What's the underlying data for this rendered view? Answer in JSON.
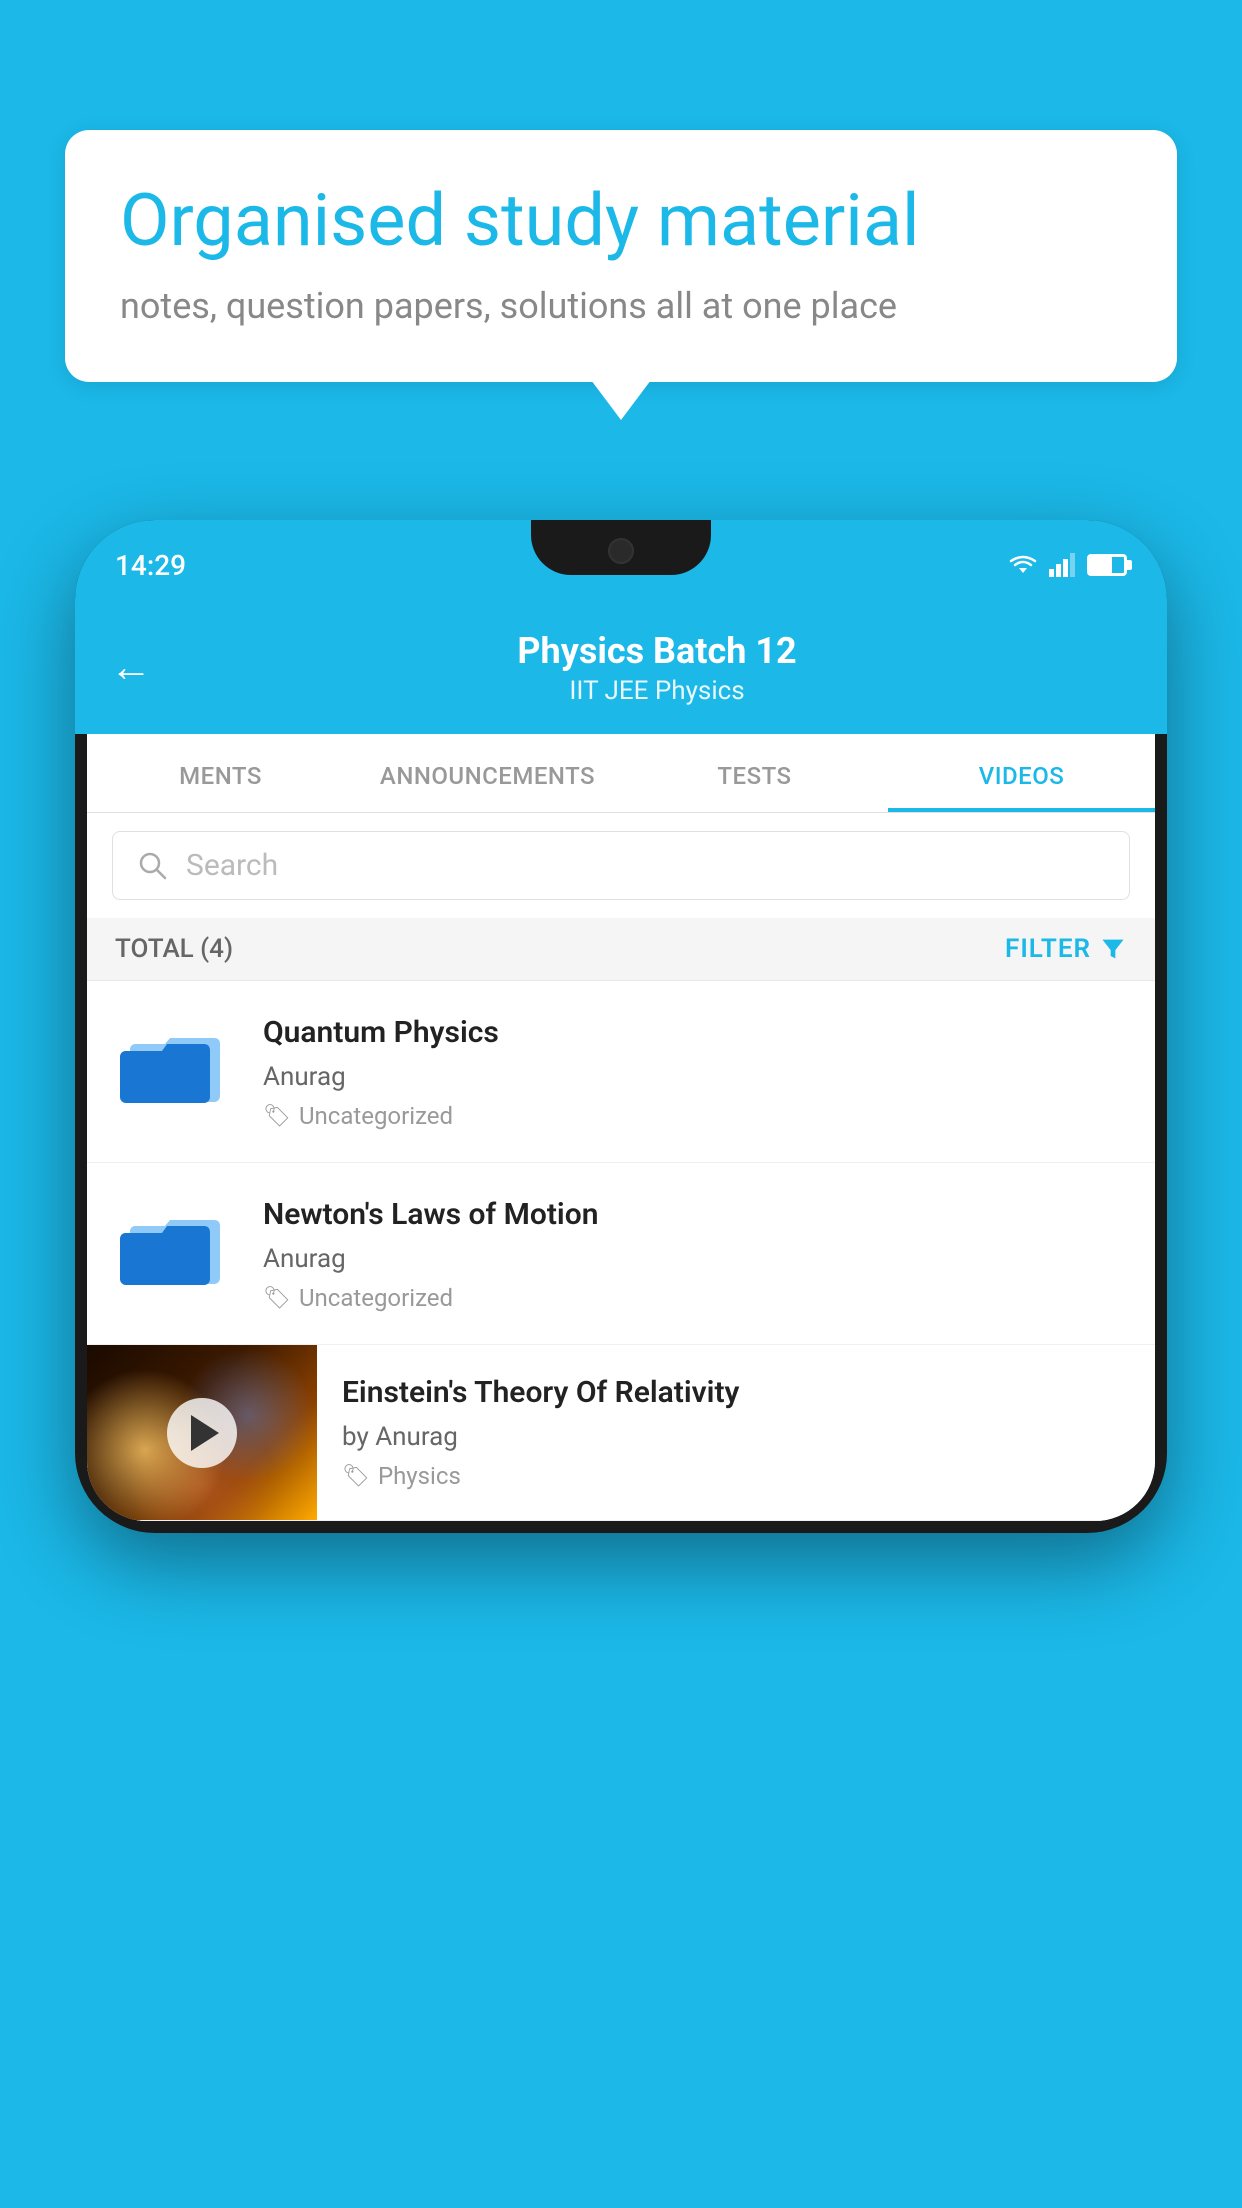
{
  "background_color": "#1BB8E8",
  "speech_bubble": {
    "title": "Organised study material",
    "subtitle": "notes, question papers, solutions all at one place"
  },
  "phone": {
    "status_bar": {
      "time": "14:29"
    },
    "header": {
      "back_label": "←",
      "title": "Physics Batch 12",
      "subtitle": "IIT JEE   Physics"
    },
    "tabs": [
      {
        "label": "MENTS",
        "active": false
      },
      {
        "label": "ANNOUNCEMENTS",
        "active": false
      },
      {
        "label": "TESTS",
        "active": false
      },
      {
        "label": "VIDEOS",
        "active": true
      }
    ],
    "search": {
      "placeholder": "Search"
    },
    "filter_bar": {
      "total_label": "TOTAL (4)",
      "filter_label": "FILTER"
    },
    "videos": [
      {
        "id": 1,
        "title": "Quantum Physics",
        "author": "Anurag",
        "tag": "Uncategorized",
        "has_thumbnail": false
      },
      {
        "id": 2,
        "title": "Newton's Laws of Motion",
        "author": "Anurag",
        "tag": "Uncategorized",
        "has_thumbnail": false
      },
      {
        "id": 3,
        "title": "Einstein's Theory Of Relativity",
        "author": "by Anurag",
        "tag": "Physics",
        "has_thumbnail": true
      }
    ]
  }
}
